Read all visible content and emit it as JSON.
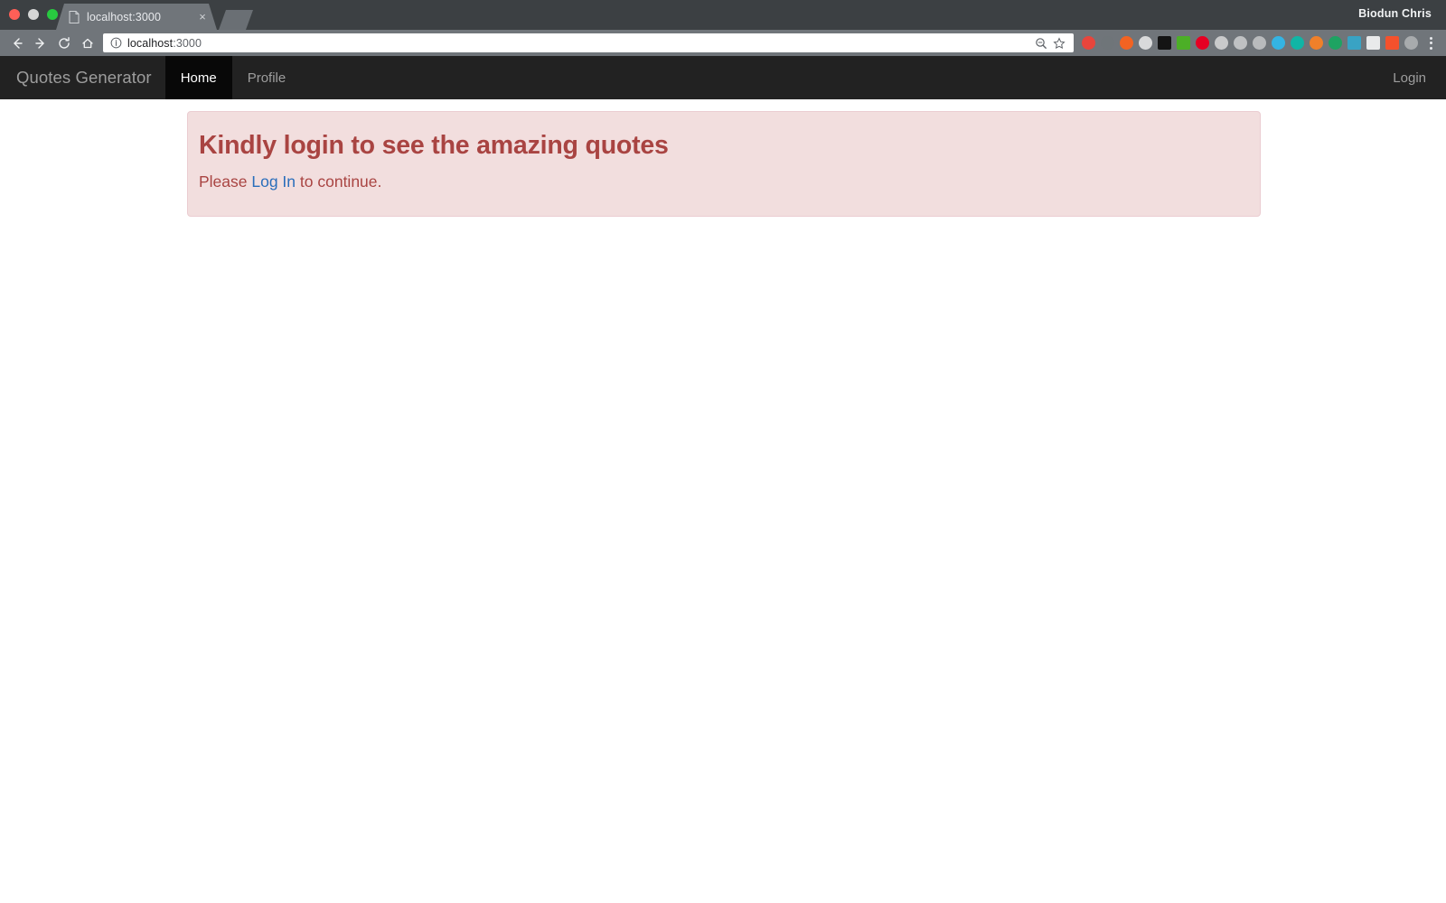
{
  "browser": {
    "profile_name": "Biodun Chris",
    "window_controls": [
      "close",
      "minimize",
      "maximize"
    ],
    "tab": {
      "title": "localhost:3000",
      "favicon": "page-icon",
      "close_label": "×"
    },
    "new_tab_label": "+",
    "toolbar": {
      "back_icon": "←",
      "forward_icon": "→",
      "reload_icon": "⟳",
      "home_icon": "⌂",
      "url_host": "localhost",
      "url_port": ":3000",
      "url_full": "localhost:3000",
      "info_icon": "info-circle-icon",
      "zoom_icon": "search-zoom-icon",
      "bookmark_icon": "star-icon",
      "menu_icon": "kebab-menu-icon"
    },
    "extensions": [
      {
        "name": "adblock-extension",
        "color": "#e8453c",
        "shape": "circle"
      },
      {
        "name": "react-devtools-extension",
        "color": "#6f7579",
        "shape": "circle"
      },
      {
        "name": "orange-extension",
        "color": "#f26322",
        "shape": "circle"
      },
      {
        "name": "opera-extension",
        "color": "#d9dadb",
        "shape": "circle"
      },
      {
        "name": "colorzilla-extension",
        "color": "#141414",
        "shape": "square"
      },
      {
        "name": "cors-extension",
        "color": "#4caf27",
        "shape": "square"
      },
      {
        "name": "pinterest-extension",
        "color": "#e60023",
        "shape": "circle"
      },
      {
        "name": "grey-extension",
        "color": "#c9cacb",
        "shape": "circle"
      },
      {
        "name": "lightshot-extension",
        "color": "#bfc1c3",
        "shape": "circle"
      },
      {
        "name": "pocket-extension",
        "color": "#b9bbbd",
        "shape": "circle"
      },
      {
        "name": "colorpicker-extension",
        "color": "#34b4e3",
        "shape": "circle"
      },
      {
        "name": "grammarly-extension",
        "color": "#11b5a5",
        "shape": "circle"
      },
      {
        "name": "mega-extension",
        "color": "#f0802a",
        "shape": "circle"
      },
      {
        "name": "google-drive-extension",
        "color": "#1ea362",
        "shape": "circle"
      },
      {
        "name": "momentum-extension",
        "color": "#39a3c4",
        "shape": "square"
      },
      {
        "name": "s-extension",
        "color": "#e9eaeb",
        "shape": "square"
      },
      {
        "name": "wappalyzer-extension",
        "color": "#f4512c",
        "shape": "square"
      },
      {
        "name": "mail-extension",
        "color": "#a8abad",
        "shape": "circle"
      }
    ]
  },
  "navbar": {
    "brand": "Quotes Generator",
    "items": [
      {
        "label": "Home",
        "name": "nav-item-home",
        "active": true
      },
      {
        "label": "Profile",
        "name": "nav-item-profile",
        "active": false
      }
    ],
    "right_items": [
      {
        "label": "Login",
        "name": "nav-item-login"
      }
    ]
  },
  "alert": {
    "type": "danger",
    "heading": "Kindly login to see the amazing quotes",
    "text_before": "Please ",
    "link_label": "Log In",
    "text_after": " to continue.",
    "colors": {
      "background": "#f2dede",
      "border": "#ebccd1",
      "text": "#a94442",
      "link": "#2a6ebb"
    }
  }
}
